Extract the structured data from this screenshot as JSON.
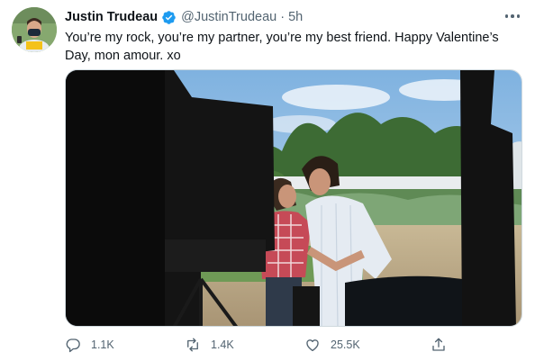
{
  "tweet": {
    "author_name": "Justin Trudeau",
    "handle": "@JustinTrudeau",
    "separator": "·",
    "time": "5h",
    "text": "You’re my rock, you’re my partner, you’re my best friend. Happy Valentine’s Day, mon amour. xo",
    "icons": {
      "verified": "verified-badge-icon",
      "more": "more-options-icon",
      "reply": "reply-icon",
      "retweet": "retweet-icon",
      "like": "like-icon",
      "share": "share-icon"
    },
    "colors": {
      "verified": "#1d9bf0",
      "secondary_text": "#536471"
    },
    "stats": {
      "replies": "1.1K",
      "retweets": "1.4K",
      "likes": "25.5K"
    }
  }
}
